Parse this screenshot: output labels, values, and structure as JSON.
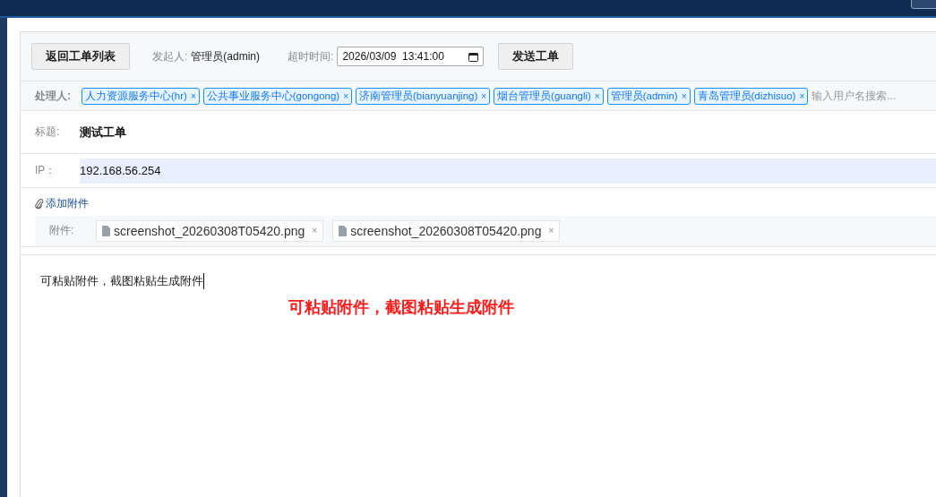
{
  "toolbar": {
    "back_button": "返回工单列表",
    "initiator_label": "发起人:",
    "initiator": "管理员(admin)",
    "timeout_label": "超时时间:",
    "timeout_value": "2026/03/09  13:41:00",
    "send_button": "发送工单"
  },
  "handlers": {
    "label": "处理人:",
    "tags": [
      {
        "name": "人力资源服务中心(hr)",
        "remove": "×"
      },
      {
        "name": "公共事业服务中心(gongong)",
        "remove": "×"
      },
      {
        "name": "济南管理员(bianyuanjing)",
        "remove": "×"
      },
      {
        "name": "烟台管理员(guangli)",
        "remove": "×"
      },
      {
        "name": "管理员(admin)",
        "remove": "×"
      },
      {
        "name": "青岛管理员(dizhisuo)",
        "remove": "×"
      }
    ],
    "placeholder": "输入用户名搜索..."
  },
  "title_field": {
    "label": "标题:",
    "value": "测试工单"
  },
  "ip_field": {
    "label": "IP：",
    "value": "192.168.56.254"
  },
  "attachments": {
    "add_link": "添加附件",
    "label": "附件:",
    "files": [
      {
        "name": "screenshot_20260308T05420.png",
        "remove": "×"
      },
      {
        "name": "screenshot_20260308T05420.png",
        "remove": "×"
      }
    ]
  },
  "editor": {
    "content": "可粘贴附件，截图粘贴生成附件"
  },
  "annotation": "可粘贴附件，截图粘贴生成附件"
}
